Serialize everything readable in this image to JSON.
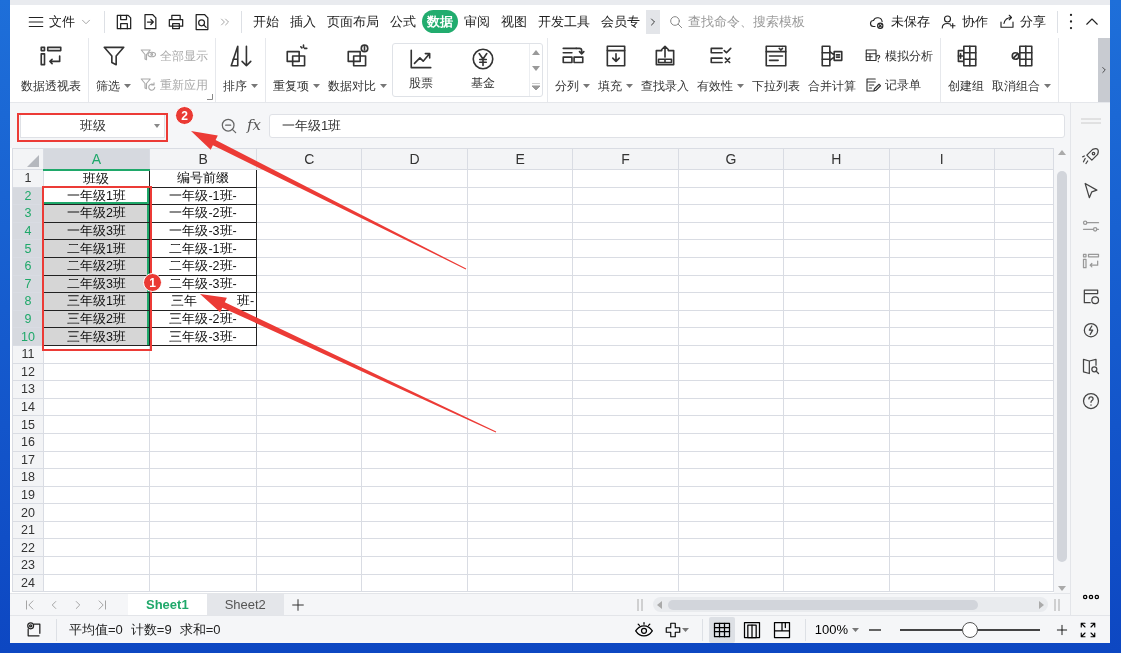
{
  "menu_bar": {
    "file_menu": "文件",
    "tabs": [
      {
        "label": "开始",
        "selected": false
      },
      {
        "label": "插入",
        "selected": false
      },
      {
        "label": "页面布局",
        "selected": false
      },
      {
        "label": "公式",
        "selected": false
      },
      {
        "label": "数据",
        "selected": true
      },
      {
        "label": "审阅",
        "selected": false
      },
      {
        "label": "视图",
        "selected": false
      },
      {
        "label": "开发工具",
        "selected": false
      },
      {
        "label": "会员专",
        "selected": false
      }
    ],
    "search": {
      "placeholder": "查找命令、搜索模板"
    },
    "actions": [
      "未保存",
      "协作",
      "分享"
    ]
  },
  "ribbon": {
    "groups": [
      {
        "items": [
          {
            "kind": "large",
            "label": "数据透视表",
            "dropdown": false
          }
        ]
      },
      {
        "dialog_launcher": true,
        "items": [
          {
            "kind": "large",
            "label": "筛选",
            "dropdown": true
          },
          {
            "kind": "stack",
            "items": [
              {
                "label": "全部显示",
                "disabled": true
              },
              {
                "label": "重新应用",
                "disabled": true
              }
            ]
          }
        ]
      },
      {
        "items": [
          {
            "kind": "large",
            "label": "排序",
            "dropdown": true
          }
        ]
      },
      {
        "items": [
          {
            "kind": "large",
            "label": "重复项",
            "dropdown": true
          },
          {
            "kind": "large",
            "label": "数据对比",
            "dropdown": true
          },
          {
            "kind": "gallery",
            "items": [
              "股票",
              "基金"
            ]
          }
        ]
      },
      {
        "items": [
          {
            "kind": "large",
            "label": "分列",
            "dropdown": true
          },
          {
            "kind": "large",
            "label": "填充",
            "dropdown": true
          },
          {
            "kind": "large",
            "label": "查找录入",
            "dropdown": false
          },
          {
            "kind": "large",
            "label": "有效性",
            "dropdown": true
          },
          {
            "kind": "large",
            "label": "下拉列表",
            "dropdown": false
          },
          {
            "kind": "large",
            "label": "合并计算",
            "dropdown": false
          },
          {
            "kind": "stack",
            "items": [
              {
                "label": "模拟分析",
                "disabled": false
              },
              {
                "label": "记录单",
                "disabled": false
              }
            ]
          }
        ]
      },
      {
        "items": [
          {
            "kind": "large",
            "label": "创建组",
            "dropdown": false
          },
          {
            "kind": "large",
            "label": "取消组合",
            "dropdown": true
          }
        ]
      }
    ]
  },
  "name_box": {
    "value": "班级"
  },
  "formula_bar": {
    "label": "fx",
    "value": "一年级1班"
  },
  "grid": {
    "columns": [
      {
        "label": "A",
        "selected": true
      },
      {
        "label": "B",
        "selected": false
      },
      {
        "label": "C",
        "selected": false
      },
      {
        "label": "D",
        "selected": false
      },
      {
        "label": "E",
        "selected": false
      },
      {
        "label": "F",
        "selected": false
      },
      {
        "label": "G",
        "selected": false
      },
      {
        "label": "H",
        "selected": false
      },
      {
        "label": "I",
        "selected": false
      }
    ],
    "rows": [
      {
        "label": "1",
        "selected": false,
        "cells": [
          {
            "text": "班级",
            "selected": false,
            "active": false
          },
          {
            "text": "编号前缀",
            "selected": false,
            "active": false
          }
        ]
      },
      {
        "label": "2",
        "selected": true,
        "cells": [
          {
            "text": "一年级1班",
            "selected": true,
            "active": true
          },
          {
            "text": "一年级-1班-",
            "selected": false,
            "active": false
          }
        ]
      },
      {
        "label": "3",
        "selected": true,
        "cells": [
          {
            "text": "一年级2班",
            "selected": true,
            "active": false
          },
          {
            "text": "一年级-2班-",
            "selected": false,
            "active": false
          }
        ]
      },
      {
        "label": "4",
        "selected": true,
        "cells": [
          {
            "text": "一年级3班",
            "selected": true,
            "active": false
          },
          {
            "text": "一年级-3班-",
            "selected": false,
            "active": false
          }
        ]
      },
      {
        "label": "5",
        "selected": true,
        "cells": [
          {
            "text": "二年级1班",
            "selected": true,
            "active": false
          },
          {
            "text": "二年级-1班-",
            "selected": false,
            "active": false
          }
        ]
      },
      {
        "label": "6",
        "selected": true,
        "cells": [
          {
            "text": "二年级2班",
            "selected": true,
            "active": false
          },
          {
            "text": "二年级-2班-",
            "selected": false,
            "active": false
          }
        ]
      },
      {
        "label": "7",
        "selected": true,
        "cells": [
          {
            "text": "二年级3班",
            "selected": true,
            "active": false
          },
          {
            "text": "二年级-3班-",
            "selected": false,
            "active": false
          }
        ]
      },
      {
        "label": "8",
        "selected": true,
        "cells": [
          {
            "text": "三年级1班",
            "selected": true,
            "active": false
          },
          {
            "fragments": [
              "三年",
              "班-"
            ],
            "selected": false,
            "active": false
          }
        ]
      },
      {
        "label": "9",
        "selected": true,
        "cells": [
          {
            "text": "三年级2班",
            "selected": true,
            "active": false
          },
          {
            "text": "三年级-2班-",
            "selected": false,
            "active": false
          }
        ]
      },
      {
        "label": "10",
        "selected": true,
        "cells": [
          {
            "text": "三年级3班",
            "selected": true,
            "active": false
          },
          {
            "text": "三年级-3班-",
            "selected": false,
            "active": false
          }
        ]
      },
      {
        "label": "11",
        "selected": false
      },
      {
        "label": "12",
        "selected": false
      },
      {
        "label": "13",
        "selected": false
      },
      {
        "label": "14",
        "selected": false
      },
      {
        "label": "15",
        "selected": false
      },
      {
        "label": "16",
        "selected": false
      },
      {
        "label": "17",
        "selected": false
      },
      {
        "label": "18",
        "selected": false
      },
      {
        "label": "19",
        "selected": false
      },
      {
        "label": "20",
        "selected": false
      },
      {
        "label": "21",
        "selected": false
      },
      {
        "label": "22",
        "selected": false
      },
      {
        "label": "23",
        "selected": false
      },
      {
        "label": "24",
        "selected": false
      }
    ]
  },
  "sheets": [
    {
      "label": "Sheet1",
      "selected": true
    },
    {
      "label": "Sheet2",
      "selected": false
    }
  ],
  "status_bar": {
    "stats": [
      "平均值=0",
      "计数=9",
      "求和=0"
    ],
    "view_modes": [
      {
        "selected": true
      },
      {
        "selected": false
      },
      {
        "selected": false
      }
    ],
    "zoom": "100%",
    "zoom_slider": {
      "level": 0.5
    }
  },
  "annotations": [
    {
      "kind": "frame"
    },
    {
      "kind": "badge",
      "text": "2"
    },
    {
      "kind": "arrow"
    },
    {
      "kind": "frame"
    },
    {
      "kind": "badge",
      "text": "1"
    },
    {
      "kind": "arrow"
    }
  ]
}
